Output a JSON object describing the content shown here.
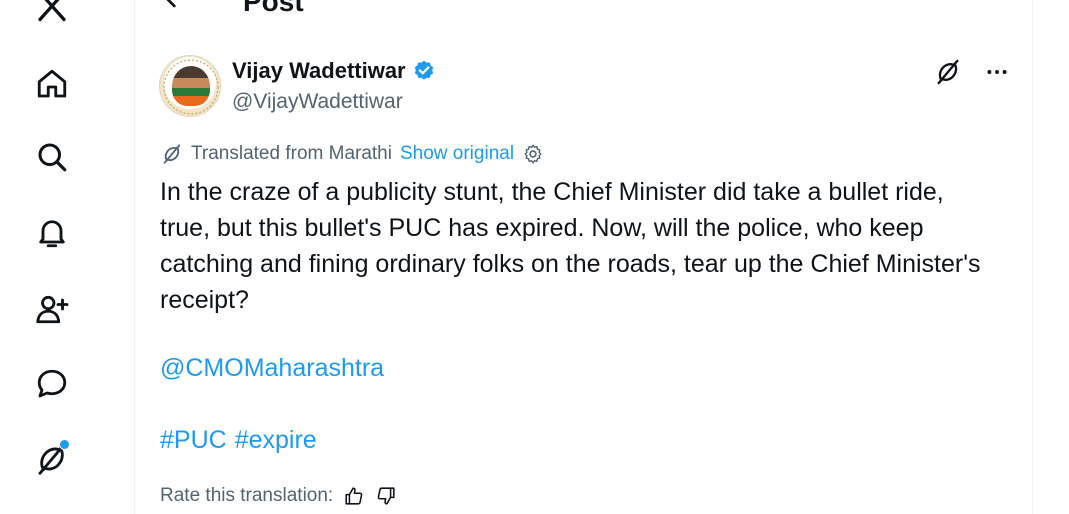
{
  "nav": {
    "items": [
      {
        "icon": "x-logo-icon"
      },
      {
        "icon": "home-icon"
      },
      {
        "icon": "search-icon"
      },
      {
        "icon": "bell-icon"
      },
      {
        "icon": "add-user-icon"
      },
      {
        "icon": "chat-bubble-icon"
      },
      {
        "icon": "grok-icon",
        "badge": true
      }
    ]
  },
  "header": {
    "title": "Post"
  },
  "post": {
    "author_name": "Vijay Wadettiwar",
    "author_handle": "@VijayWadettiwar",
    "translated_label": "Translated from Marathi",
    "show_original_label": "Show original",
    "text": "In the craze of a publicity stunt, the Chief Minister did take a bullet ride, true, but this bullet's PUC has expired. Now, will the police, who keep catching and fining ordinary folks on the roads, tear up the Chief Minister's receipt?",
    "mention": "@CMOMaharashtra",
    "hashtags": [
      "#PUC",
      "#expire"
    ],
    "rate_label": "Rate this translation:"
  },
  "colors": {
    "accent": "#1d9bf0",
    "text": "#0f1419",
    "secondary": "#536471"
  }
}
